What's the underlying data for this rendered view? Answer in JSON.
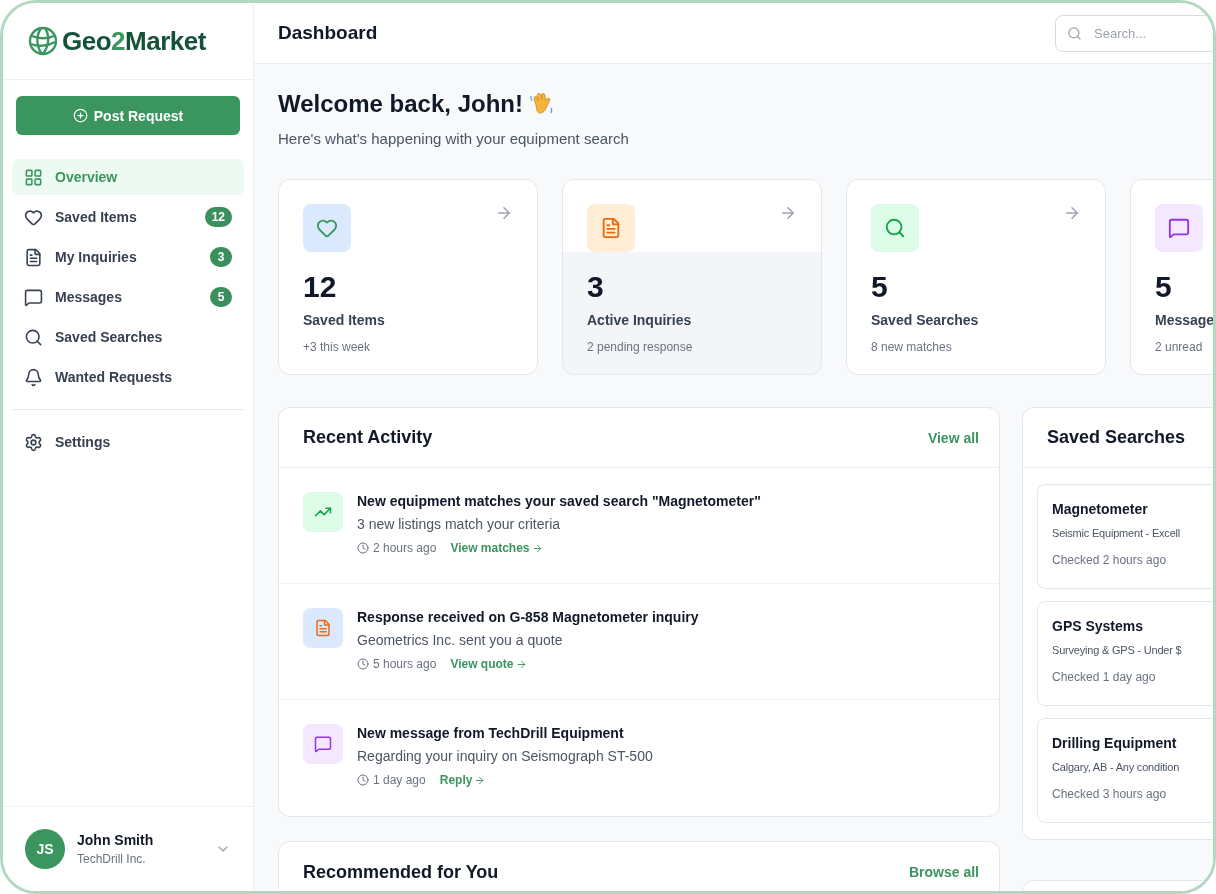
{
  "brand": {
    "name_part1": "Geo",
    "name_digit": "2",
    "name_part2": "Market"
  },
  "sidebar": {
    "post_button": "Post Request",
    "items": [
      {
        "label": "Overview",
        "kind": "grid",
        "selected": true
      },
      {
        "label": "Saved Items",
        "kind": "heart",
        "badge": "12",
        "selected": false
      },
      {
        "label": "My Inquiries",
        "kind": "document",
        "badge": "3",
        "selected": false
      },
      {
        "label": "Messages",
        "kind": "message",
        "badge": "5",
        "selected": false
      },
      {
        "label": "Saved Searches",
        "kind": "search",
        "selected": false
      },
      {
        "label": "Wanted Requests",
        "kind": "bell",
        "selected": false
      }
    ],
    "settings": {
      "label": "Settings",
      "selected": false
    },
    "user": {
      "initials": "JS",
      "name": "John Smith",
      "company": "TechDrill Inc."
    }
  },
  "header": {
    "title": "Dashboard",
    "search": {
      "placeholder": "Search..."
    }
  },
  "welcome": {
    "title": "Welcome back, John!",
    "subtitle": "Here's what's happening with your equipment search"
  },
  "stats": [
    {
      "kind": "heart",
      "color": "#dbe9fe",
      "value": "12",
      "label": "Saved Items",
      "note": "+3 this week",
      "hovered": false
    },
    {
      "kind": "document",
      "color": "#ffedd5",
      "value": "3",
      "label": "Active Inquiries",
      "note": "2 pending response",
      "hovered": true
    },
    {
      "kind": "search",
      "color": "#dcfce7",
      "value": "5",
      "label": "Saved Searches",
      "note": "8 new matches",
      "hovered": false
    },
    {
      "kind": "message",
      "color": "#f3e8ff",
      "value": "5",
      "label": "Message",
      "note": "2 unread",
      "hovered": false
    }
  ],
  "recent_activity": {
    "title": "Recent Activity",
    "link": "View all",
    "items": [
      {
        "kind": "trend",
        "color": "#dcfce7",
        "title": "New equipment matches your saved search \"Magnetometer\"",
        "detail": "3 new listings match your criteria",
        "time": "2 hours ago",
        "action": "View matches"
      },
      {
        "kind": "document",
        "color": "#dbe9fe",
        "title": "Response received on G-858 Magnetometer inquiry",
        "detail": "Geometrics Inc. sent you a quote",
        "time": "5 hours ago",
        "action": "View quote"
      },
      {
        "kind": "message",
        "color": "#f3e8ff",
        "title": "New message from TechDrill Equipment",
        "detail": "Regarding your inquiry on Seismograph ST-500",
        "time": "1 day ago",
        "action": "Reply"
      }
    ]
  },
  "recommended": {
    "title": "Recommended for You",
    "link": "Browse all"
  },
  "saved_searches": {
    "title": "Saved Searches",
    "items": [
      {
        "name": "Magnetometer",
        "criteria": "Seismic Equipment - Excell",
        "checked": "Checked 2 hours ago"
      },
      {
        "name": "GPS Systems",
        "criteria": "Surveying & GPS - Under $",
        "checked": "Checked 1 day ago"
      },
      {
        "name": "Drilling Equipment",
        "criteria": "Calgary, AB - Any condition",
        "checked": "Checked 3 hours ago"
      }
    ]
  }
}
